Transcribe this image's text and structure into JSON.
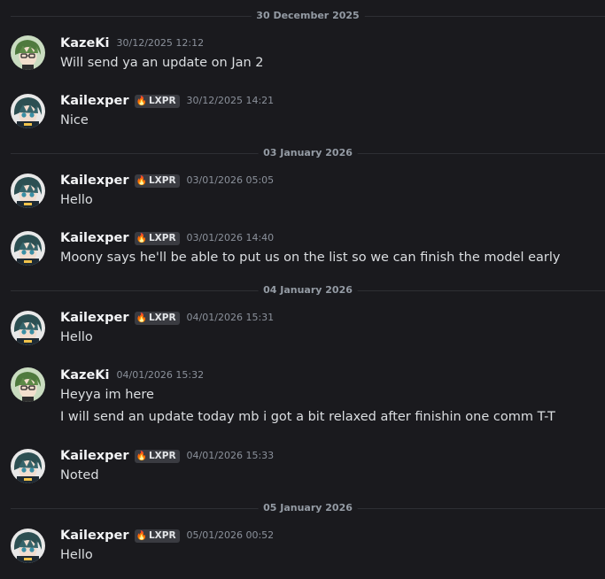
{
  "dividers": [
    {
      "label": "30 December 2025"
    },
    {
      "label": "03 January 2026"
    },
    {
      "label": "04 January 2026"
    },
    {
      "label": "05 January 2026"
    }
  ],
  "users": {
    "kazeki": {
      "name": "KazeKi"
    },
    "kailexper": {
      "name": "Kailexper",
      "badge": "LXPR",
      "badge_icon": "🔥"
    }
  },
  "messages": [
    {
      "user": "KazeKi",
      "timestamp": "30/12/2025 12:12",
      "lines": [
        "Will send ya an update on Jan 2"
      ]
    },
    {
      "user": "Kailexper",
      "badge": "LXPR",
      "timestamp": "30/12/2025 14:21",
      "lines": [
        "Nice"
      ]
    },
    {
      "user": "Kailexper",
      "badge": "LXPR",
      "timestamp": "03/01/2026 05:05",
      "lines": [
        "Hello"
      ]
    },
    {
      "user": "Kailexper",
      "badge": "LXPR",
      "timestamp": "03/01/2026 14:40",
      "lines": [
        "Moony says he'll be able to put us on the list so we can finish the model early"
      ]
    },
    {
      "user": "Kailexper",
      "badge": "LXPR",
      "timestamp": "04/01/2026 15:31",
      "lines": [
        "Hello"
      ]
    },
    {
      "user": "KazeKi",
      "timestamp": "04/01/2026 15:32",
      "lines": [
        "Heyya im here",
        "I will send an update today mb i got a bit relaxed after finishin one comm T-T"
      ]
    },
    {
      "user": "Kailexper",
      "badge": "LXPR",
      "timestamp": "04/01/2026 15:33",
      "lines": [
        "Noted"
      ]
    },
    {
      "user": "Kailexper",
      "badge": "LXPR",
      "timestamp": "05/01/2026 00:52",
      "lines": [
        "Hello"
      ]
    }
  ],
  "colors": {
    "background": "#1a1a1e",
    "username": "#f2f3f5",
    "message_text": "#dbdee1",
    "timestamp": "#8b919b",
    "divider": "#2e2f34",
    "badge_bg": "#3a3b41",
    "badge_icon": "#ff8c2e"
  }
}
